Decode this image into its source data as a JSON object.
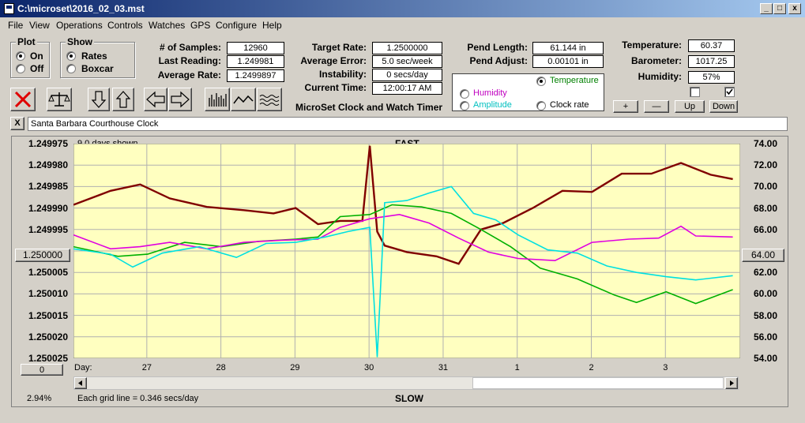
{
  "window": {
    "title": "C:\\microset\\2016_02_03.mst",
    "min_glyph": "_",
    "max_glyph": "□",
    "close_glyph": "x"
  },
  "menu": [
    "File",
    "View",
    "Operations",
    "Controls",
    "Watches",
    "GPS",
    "Configure",
    "Help"
  ],
  "plot_group": {
    "title": "Plot",
    "on": "On",
    "off": "Off",
    "selected": "On"
  },
  "show_group": {
    "title": "Show",
    "rates": "Rates",
    "boxcar": "Boxcar",
    "selected": "Rates"
  },
  "stats": {
    "samples_label": "# of Samples:",
    "samples": "12960",
    "last_label": "Last Reading:",
    "last": "1.249981",
    "avg_label": "Average Rate:",
    "avg": "1.2499897"
  },
  "rates": {
    "target_label": "Target Rate:",
    "target": "1.2500000",
    "avgerr_label": "Average Error:",
    "avgerr": "5.0 sec/week",
    "instab_label": "Instability:",
    "instab": "0 secs/day",
    "time_label": "Current Time:",
    "time": "12:00:17 AM",
    "app_name": "MicroSet Clock and Watch Timer"
  },
  "pendulum": {
    "length_label": "Pend Length:",
    "length": "61.144 in",
    "adjust_label": "Pend Adjust:",
    "adjust": "0.00101 in"
  },
  "sensor_select": {
    "temperature": "Temperature",
    "humidity": "Humidity",
    "amplitude": "Amplitude",
    "clock_rate": "Clock rate",
    "selected": "Temperature",
    "colors": {
      "temperature": "#008000",
      "humidity": "#c000c0",
      "amplitude": "#00c0c0",
      "clock_rate": "#000000"
    }
  },
  "env": {
    "temp_label": "Temperature:",
    "temp": "60.37",
    "baro_label": "Barometer:",
    "baro": "1017.25",
    "hum_label": "Humidity:",
    "hum": "57%"
  },
  "adjust_buttons": {
    "plus": "+",
    "minus": "—",
    "up": "Up",
    "down": "Down"
  },
  "clock_name": "Santa Barbara Courthouse Clock",
  "clear_glyph": "X",
  "plot": {
    "days_shown": "9.0 days shown",
    "fast": "FAST",
    "slow": "SLOW",
    "grid_note": "Each grid line = 0.346 secs/day",
    "percent": "2.94%",
    "left_value": "1.250000",
    "right_value": "64.00",
    "bottom_value": "0",
    "day_label": "Day:"
  },
  "chart_data": {
    "type": "line",
    "title": "",
    "ylabel_left": "",
    "ylabel_right": "",
    "x_ticks": [
      "27",
      "28",
      "29",
      "30",
      "31",
      "1",
      "2",
      "3"
    ],
    "y_left_ticks": [
      "1.249975",
      "1.249980",
      "1.249985",
      "1.249990",
      "1.249995",
      "1.250000",
      "1.250005",
      "1.250010",
      "1.250015",
      "1.250020",
      "1.250025"
    ],
    "y_right_ticks": [
      "74.00",
      "72.00",
      "70.00",
      "68.00",
      "66.00",
      "64.00",
      "62.00",
      "60.00",
      "58.00",
      "56.00",
      "54.00"
    ],
    "x_range_days": [
      0,
      9
    ],
    "y_right_range": [
      54,
      74
    ],
    "grid": true,
    "series": [
      {
        "name": "Clock rate",
        "color": "#800000",
        "points": [
          [
            0,
            68.3
          ],
          [
            0.5,
            69.6
          ],
          [
            0.9,
            70.2
          ],
          [
            1.3,
            68.9
          ],
          [
            1.8,
            68.1
          ],
          [
            2.3,
            67.8
          ],
          [
            2.7,
            67.5
          ],
          [
            3.0,
            68.0
          ],
          [
            3.3,
            66.5
          ],
          [
            3.6,
            66.8
          ],
          [
            3.9,
            66.8
          ],
          [
            4.0,
            73.8
          ],
          [
            4.1,
            65.8
          ],
          [
            4.2,
            64.5
          ],
          [
            4.5,
            63.9
          ],
          [
            4.9,
            63.5
          ],
          [
            5.2,
            62.8
          ],
          [
            5.5,
            66.0
          ],
          [
            5.8,
            66.6
          ],
          [
            6.2,
            68.0
          ],
          [
            6.6,
            69.6
          ],
          [
            7.0,
            69.5
          ],
          [
            7.4,
            71.2
          ],
          [
            7.8,
            71.2
          ],
          [
            8.2,
            72.2
          ],
          [
            8.6,
            71.1
          ],
          [
            8.9,
            70.7
          ]
        ]
      },
      {
        "name": "Temperature",
        "color": "#00b000",
        "points": [
          [
            0,
            64.4
          ],
          [
            0.6,
            63.5
          ],
          [
            1.0,
            63.7
          ],
          [
            1.5,
            64.8
          ],
          [
            2.0,
            64.4
          ],
          [
            2.5,
            64.9
          ],
          [
            3.0,
            65.1
          ],
          [
            3.3,
            65.3
          ],
          [
            3.6,
            67.2
          ],
          [
            4.0,
            67.4
          ],
          [
            4.3,
            68.3
          ],
          [
            4.7,
            68.1
          ],
          [
            5.1,
            67.5
          ],
          [
            5.5,
            66.0
          ],
          [
            5.9,
            64.4
          ],
          [
            6.3,
            62.4
          ],
          [
            6.8,
            61.4
          ],
          [
            7.3,
            59.9
          ],
          [
            7.6,
            59.2
          ],
          [
            8.0,
            60.2
          ],
          [
            8.4,
            59.1
          ],
          [
            8.9,
            60.4
          ]
        ]
      },
      {
        "name": "Humidity",
        "color": "#e000e0",
        "points": [
          [
            0,
            65.5
          ],
          [
            0.5,
            64.2
          ],
          [
            0.9,
            64.4
          ],
          [
            1.3,
            64.8
          ],
          [
            1.8,
            64.2
          ],
          [
            2.3,
            64.8
          ],
          [
            2.8,
            65.0
          ],
          [
            3.3,
            65.1
          ],
          [
            3.6,
            66.2
          ],
          [
            4.0,
            67.0
          ],
          [
            4.4,
            67.4
          ],
          [
            4.8,
            66.6
          ],
          [
            5.2,
            65.2
          ],
          [
            5.6,
            63.9
          ],
          [
            6.0,
            63.3
          ],
          [
            6.5,
            63.1
          ],
          [
            7.0,
            64.8
          ],
          [
            7.5,
            65.1
          ],
          [
            7.9,
            65.2
          ],
          [
            8.2,
            66.3
          ],
          [
            8.4,
            65.4
          ],
          [
            8.9,
            65.3
          ]
        ]
      },
      {
        "name": "Amplitude",
        "color": "#00e0e0",
        "points": [
          [
            0,
            64.2
          ],
          [
            0.5,
            63.7
          ],
          [
            0.8,
            62.5
          ],
          [
            1.2,
            63.8
          ],
          [
            1.7,
            64.4
          ],
          [
            2.2,
            63.4
          ],
          [
            2.6,
            64.7
          ],
          [
            3.0,
            64.8
          ],
          [
            3.4,
            65.3
          ],
          [
            3.7,
            65.8
          ],
          [
            4.0,
            66.2
          ],
          [
            4.1,
            54.1
          ],
          [
            4.2,
            68.5
          ],
          [
            4.5,
            68.7
          ],
          [
            4.8,
            69.4
          ],
          [
            5.1,
            70.0
          ],
          [
            5.4,
            67.5
          ],
          [
            5.7,
            66.9
          ],
          [
            6.0,
            65.5
          ],
          [
            6.4,
            64.1
          ],
          [
            6.8,
            63.8
          ],
          [
            7.2,
            62.6
          ],
          [
            7.6,
            62.0
          ],
          [
            8.0,
            61.6
          ],
          [
            8.4,
            61.3
          ],
          [
            8.9,
            61.7
          ]
        ]
      }
    ]
  }
}
